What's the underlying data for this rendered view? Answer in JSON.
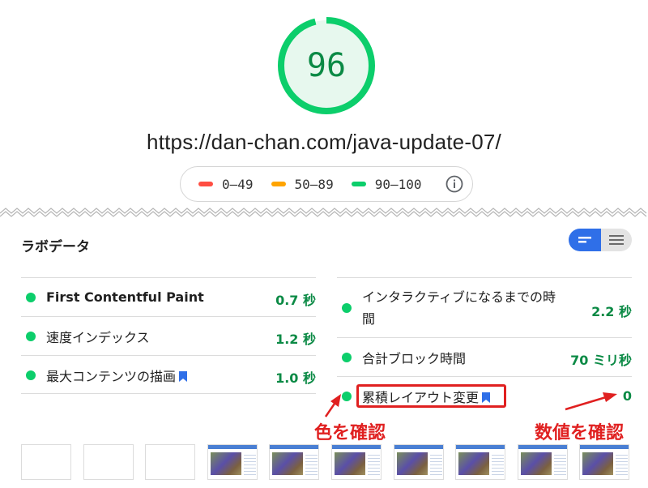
{
  "score": {
    "value": "96",
    "fraction": 0.96,
    "color": "#0cce6b"
  },
  "url": "https://dan-chan.com/java-update-07/",
  "legend": [
    {
      "range": "0–49",
      "color": "#ff4e42"
    },
    {
      "range": "50–89",
      "color": "#ffa400"
    },
    {
      "range": "90–100",
      "color": "#0cce6b"
    }
  ],
  "lab": {
    "title": "ラボデータ",
    "left_metrics": [
      {
        "label": "First Contentful Paint",
        "value": "0.7 秒",
        "status": "good"
      },
      {
        "label": "速度インデックス",
        "value": "1.2 秒",
        "status": "good"
      },
      {
        "label": "最大コンテンツの描画",
        "value": "1.0 秒",
        "status": "good",
        "bookmark": true
      }
    ],
    "right_metrics": [
      {
        "label_line1": "インタラクティブになるまでの時",
        "label_line2": "間",
        "value": "2.2 秒",
        "status": "good"
      },
      {
        "label": "合計ブロック時間",
        "value": "70 ミリ秒",
        "status": "good"
      },
      {
        "label": "累積レイアウト変更",
        "value": "0",
        "status": "good",
        "bookmark": true
      }
    ]
  },
  "annotations": {
    "color_check": "色を確認",
    "value_check": "数値を確認"
  },
  "filmstrip": {
    "blank_frames": 3,
    "screenshot_frames": 7
  }
}
